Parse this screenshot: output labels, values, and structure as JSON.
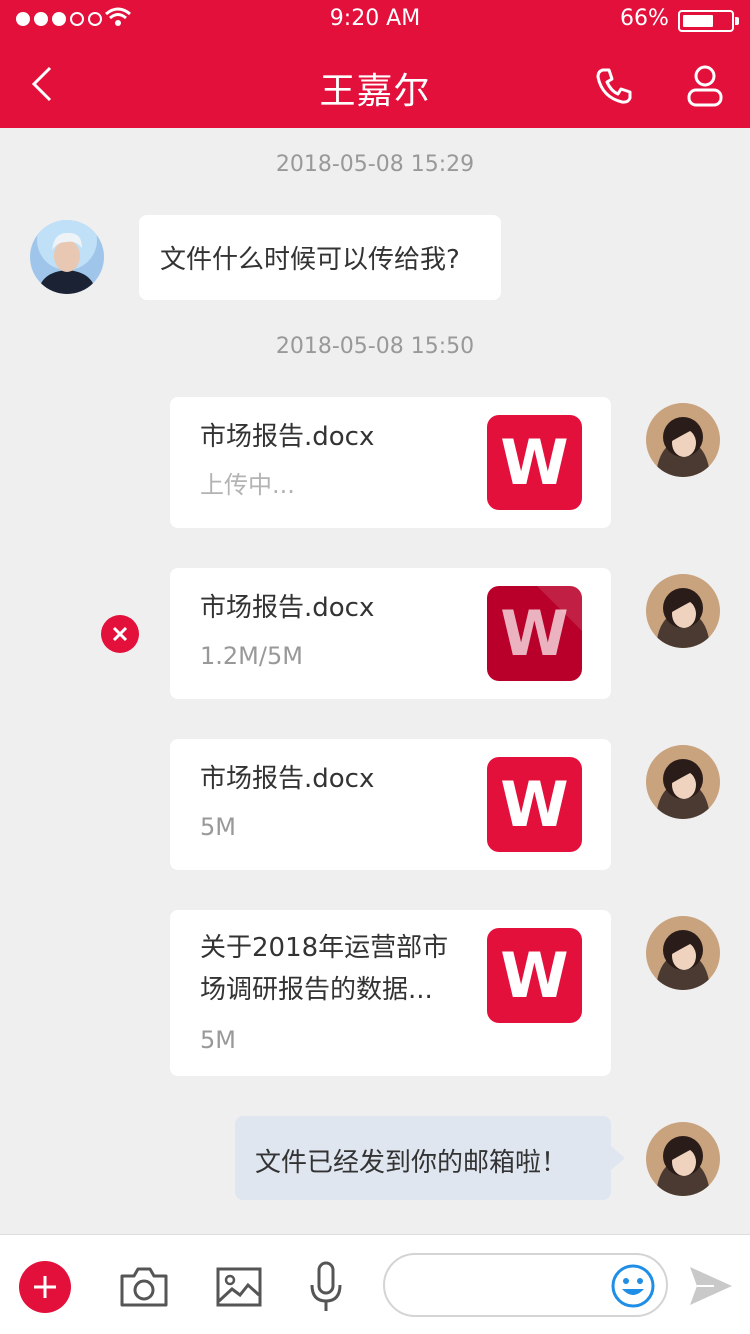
{
  "status_bar": {
    "time": "9:20 AM",
    "battery": "66%",
    "battery_level": 0.66
  },
  "header": {
    "title": "王嘉尔",
    "icons": [
      "back-icon",
      "phone-icon",
      "profile-icon"
    ]
  },
  "messages": [
    {
      "type": "timestamp",
      "text": "2018-05-08 15:29"
    },
    {
      "type": "text",
      "side": "received",
      "text": "文件什么时候可以传给我?"
    },
    {
      "type": "timestamp",
      "text": "2018-05-08 15:50"
    },
    {
      "type": "file",
      "side": "sent",
      "name": "市场报告.docx",
      "status": "上传中...",
      "icon": "W"
    },
    {
      "type": "file",
      "side": "sent",
      "name": "市场报告.docx",
      "status": "1.2M/5M",
      "icon": "W"
    },
    {
      "type": "file",
      "side": "sent",
      "name": "市场报告.docx",
      "status": "5M",
      "icon": "W"
    },
    {
      "type": "file",
      "side": "sent",
      "name_line1": "关于2018年运营部市",
      "name_line2": "场调研报告的数据...",
      "status": "5M",
      "icon": "W"
    },
    {
      "type": "text",
      "side": "sent",
      "text": "文件已经发到你的邮箱啦！"
    }
  ],
  "toolbar": {
    "icons": [
      "plus-icon",
      "camera-icon",
      "image-icon",
      "microphone-icon",
      "emoji-icon",
      "send-icon"
    ],
    "input_placeholder": ""
  },
  "colors": {
    "brand": "#e3103c",
    "background": "#efeff0",
    "sent_bubble": "#dfe6f0",
    "muted_text": "#999999"
  }
}
